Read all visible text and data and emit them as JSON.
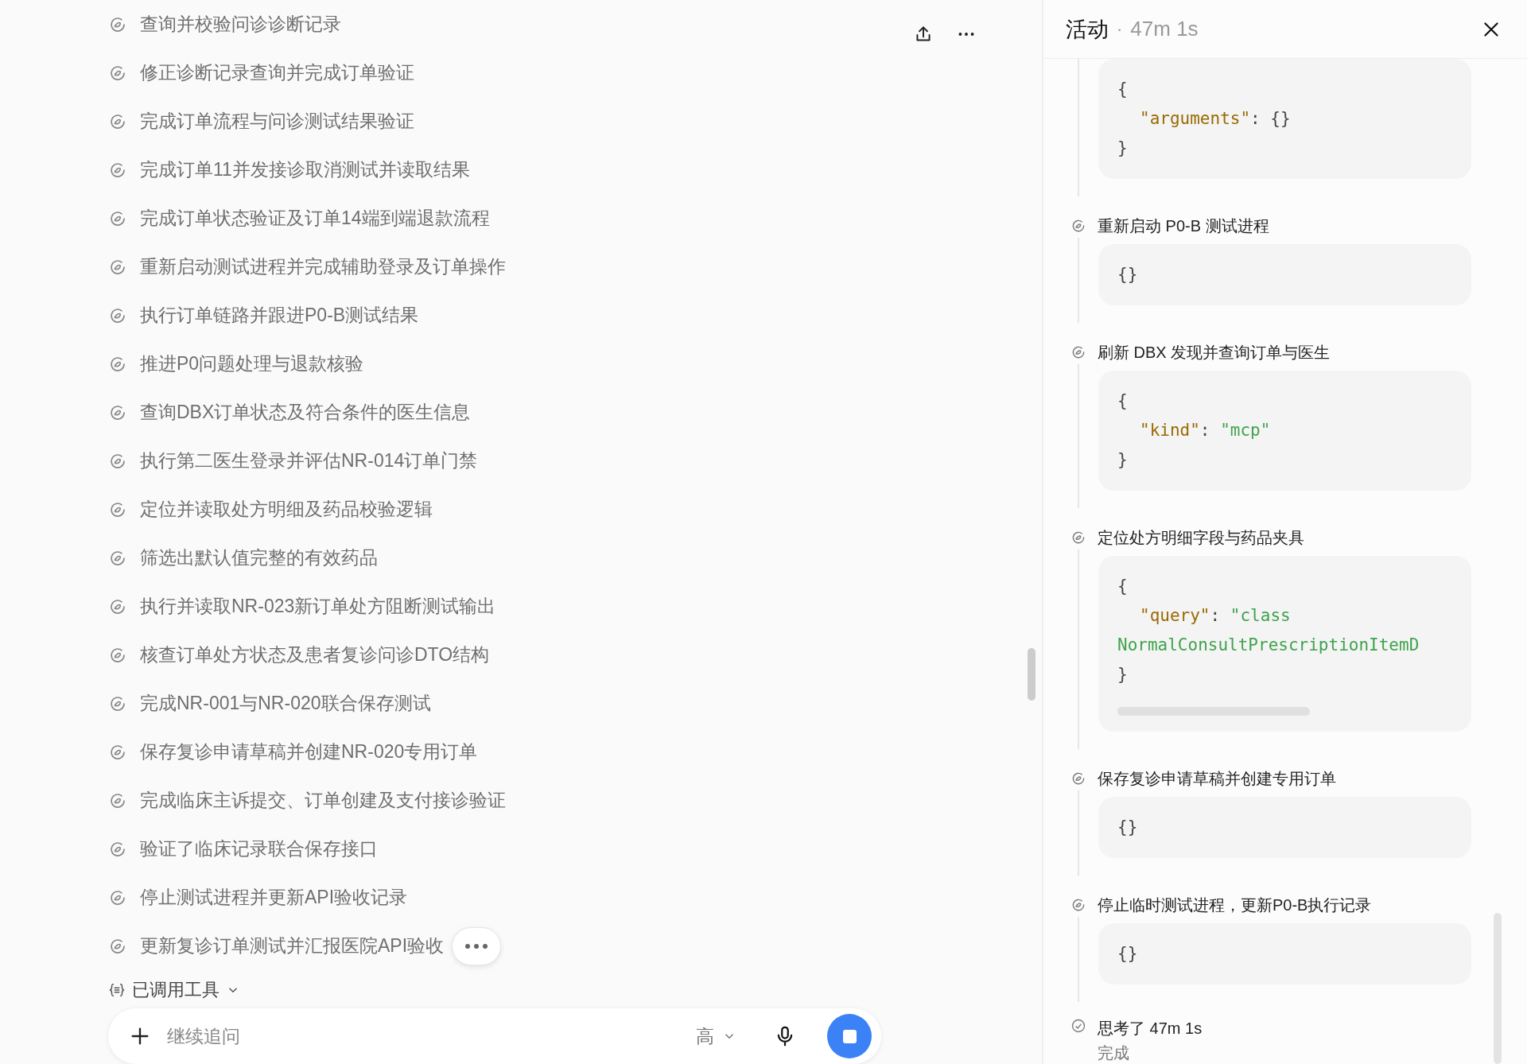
{
  "tasks": [
    "查询并校验问诊诊断记录",
    "修正诊断记录查询并完成订单验证",
    "完成订单流程与问诊测试结果验证",
    "完成订单11并发接诊取消测试并读取结果",
    "完成订单状态验证及订单14端到端退款流程",
    "重新启动测试进程并完成辅助登录及订单操作",
    "执行订单链路并跟进P0-B测试结果",
    "推进P0问题处理与退款核验",
    "查询DBX订单状态及符合条件的医生信息",
    "执行第二医生登录并评估NR-014订单门禁",
    "定位并读取处方明细及药品校验逻辑",
    "筛选出默认值完整的有效药品",
    "执行并读取NR-023新订单处方阻断测试输出",
    "核查订单处方状态及患者复诊问诊DTO结构",
    "完成NR-001与NR-020联合保存测试",
    "保存复诊申请草稿并创建NR-020专用订单",
    "完成临床主诉提交、订单创建及支付接诊验证",
    "验证了临床记录联合保存接口",
    "停止测试进程并更新API验收记录",
    "更新复诊订单测试并汇报医院API验收"
  ],
  "tool_section": {
    "label": "已调用工具",
    "expanded": false
  },
  "composer": {
    "placeholder": "继续追问",
    "effort": "高"
  },
  "activity": {
    "title": "活动",
    "separator": "·",
    "duration": "47m 1s",
    "steps": [
      {
        "scrollable": false,
        "code": [
          {
            "indent": false,
            "tokens": [
              {
                "kind": "punct",
                "text": "{"
              }
            ]
          },
          {
            "indent": true,
            "tokens": [
              {
                "kind": "key",
                "text": "\"arguments\""
              },
              {
                "kind": "punct",
                "text": ": {}"
              }
            ]
          },
          {
            "indent": false,
            "tokens": [
              {
                "kind": "punct",
                "text": "}"
              }
            ]
          }
        ]
      },
      {
        "title": "重新启动 P0-B 测试进程",
        "scrollable": false,
        "code": [
          {
            "indent": false,
            "tokens": [
              {
                "kind": "punct",
                "text": "{}"
              }
            ]
          }
        ]
      },
      {
        "title": "刷新 DBX 发现并查询订单与医生",
        "scrollable": false,
        "code": [
          {
            "indent": false,
            "tokens": [
              {
                "kind": "punct",
                "text": "{"
              }
            ]
          },
          {
            "indent": true,
            "tokens": [
              {
                "kind": "key",
                "text": "\"kind\""
              },
              {
                "kind": "punct",
                "text": ": "
              },
              {
                "kind": "string",
                "text": "\"mcp\""
              }
            ]
          },
          {
            "indent": false,
            "tokens": [
              {
                "kind": "punct",
                "text": "}"
              }
            ]
          }
        ]
      },
      {
        "title": "定位处方明细字段与药品夹具",
        "scrollable": true,
        "code": [
          {
            "indent": false,
            "tokens": [
              {
                "kind": "punct",
                "text": "{"
              }
            ]
          },
          {
            "indent": true,
            "tokens": [
              {
                "kind": "key",
                "text": "\"query\""
              },
              {
                "kind": "punct",
                "text": ": "
              },
              {
                "kind": "string",
                "text": "\"class"
              }
            ]
          },
          {
            "indent": false,
            "tokens": [
              {
                "kind": "string",
                "text": "NormalConsultPrescriptionItemD"
              }
            ]
          },
          {
            "indent": false,
            "tokens": [
              {
                "kind": "punct",
                "text": "}"
              }
            ]
          }
        ]
      },
      {
        "title": "保存复诊申请草稿并创建专用订单",
        "scrollable": false,
        "code": [
          {
            "indent": false,
            "tokens": [
              {
                "kind": "punct",
                "text": "{}"
              }
            ]
          }
        ]
      },
      {
        "title": "停止临时测试进程，更新P0-B执行记录",
        "scrollable": false,
        "code": [
          {
            "indent": false,
            "tokens": [
              {
                "kind": "punct",
                "text": "{}"
              }
            ]
          }
        ]
      }
    ],
    "summary": {
      "title": "思考了 47m 1s",
      "status": "完成"
    }
  }
}
